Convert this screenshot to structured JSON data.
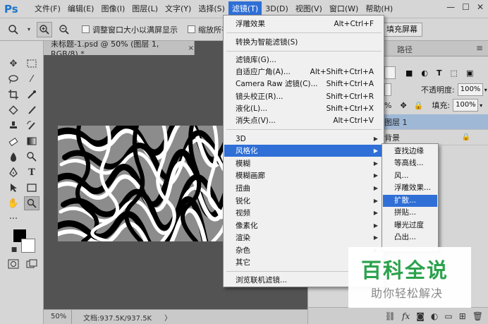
{
  "app": {
    "logo": "Ps"
  },
  "menubar": {
    "items": [
      "文件(F)",
      "编辑(E)",
      "图像(I)",
      "图层(L)",
      "文字(Y)",
      "选择(S)",
      "滤镜(T)",
      "3D(D)",
      "视图(V)",
      "窗口(W)",
      "帮助(H)"
    ],
    "active_index": 6,
    "window_controls": [
      "—",
      "☐",
      "✕"
    ]
  },
  "options": {
    "resize_windows_label": "调整窗口大小以满屏显示",
    "zoom_all_label": "缩放所有窗",
    "fill_screen_label": "填充屏幕"
  },
  "document": {
    "tab_title": "未标题-1.psd @ 50% (图层 1, RGB/8) *",
    "tab_close": "×"
  },
  "status": {
    "zoom": "50%",
    "doc_size": "文档:937.5K/937.5K",
    "arrow": "〉"
  },
  "panels": {
    "tabs": [
      "路径"
    ],
    "opacity_label": "不透明度:",
    "opacity_value": "100%",
    "fill_label": "填充:",
    "fill_value": "100%",
    "normal_value": "%",
    "layers": [
      {
        "name": "图层 1",
        "selected": true
      },
      {
        "name": "背景",
        "locked": true
      }
    ]
  },
  "filter_menu": {
    "groups": [
      [
        {
          "label": "浮雕效果",
          "shortcut": "Alt+Ctrl+F"
        }
      ],
      [
        {
          "label": "转换为智能滤镜(S)",
          "shortcut": ""
        }
      ],
      [
        {
          "label": "滤镜库(G)...",
          "shortcut": ""
        },
        {
          "label": "自适应广角(A)...",
          "shortcut": "Alt+Shift+Ctrl+A"
        },
        {
          "label": "Camera Raw 滤镜(C)...",
          "shortcut": "Shift+Ctrl+A"
        },
        {
          "label": "镜头校正(R)...",
          "shortcut": "Shift+Ctrl+R"
        },
        {
          "label": "液化(L)...",
          "shortcut": "Shift+Ctrl+X"
        },
        {
          "label": "消失点(V)...",
          "shortcut": "Alt+Ctrl+V"
        }
      ],
      [
        {
          "label": "3D",
          "submenu": true
        },
        {
          "label": "风格化",
          "submenu": true,
          "highlighted": true
        },
        {
          "label": "模糊",
          "submenu": true
        },
        {
          "label": "模糊画廊",
          "submenu": true
        },
        {
          "label": "扭曲",
          "submenu": true
        },
        {
          "label": "锐化",
          "submenu": true
        },
        {
          "label": "视频",
          "submenu": true
        },
        {
          "label": "像素化",
          "submenu": true
        },
        {
          "label": "渲染",
          "submenu": true
        },
        {
          "label": "杂色",
          "submenu": true
        },
        {
          "label": "其它",
          "submenu": true
        }
      ],
      [
        {
          "label": "浏览联机滤镜...",
          "shortcut": ""
        }
      ]
    ]
  },
  "stylize_submenu": {
    "items": [
      "查找边缘",
      "等高线...",
      "风...",
      "浮雕效果...",
      "扩散...",
      "拼贴...",
      "曝光过度",
      "凸出..."
    ],
    "highlighted_index": 4
  },
  "watermark": {
    "title": "百科全说",
    "subtitle": "助你轻松解决"
  },
  "colors": {
    "highlight": "#2f6fd6",
    "ui_bg": "#d6d6d6",
    "canvas_bg": "#535353",
    "watermark_green": "#2aa24c"
  }
}
